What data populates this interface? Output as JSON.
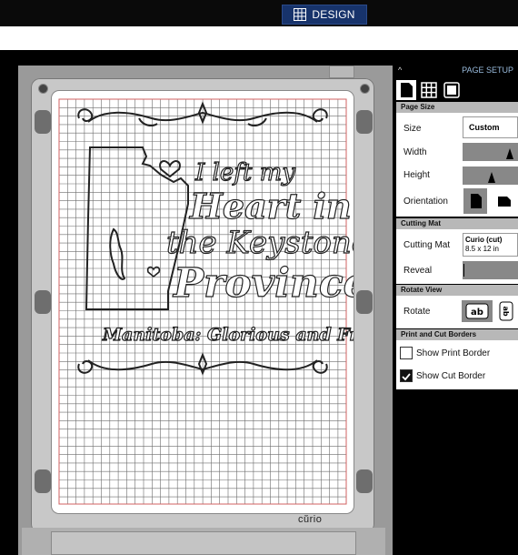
{
  "toolbar": {
    "design_tab_label": "DESIGN",
    "design_icon": "grid-icon"
  },
  "mat": {
    "brand_logo": "cŭrio",
    "design_text_lines": [
      "I left my",
      "Heart in",
      "the Keystone",
      "Province"
    ],
    "design_tagline": "Manitoba: Glorious and Free"
  },
  "panel": {
    "collapse_icon": "chevron-up-icon",
    "title": "PAGE SETUP",
    "view_icons": [
      "page-icon",
      "grid-icon",
      "mat-icon"
    ],
    "page_size": {
      "section": "Page Size",
      "size_label": "Size",
      "size_value": "Custom",
      "width_label": "Width",
      "height_label": "Height",
      "orientation_label": "Orientation",
      "orientation_icons": [
        "portrait-icon",
        "landscape-icon"
      ]
    },
    "cutting_mat": {
      "section": "Cutting Mat",
      "label": "Cutting Mat",
      "value_line1": "Curio (cut)",
      "value_line2": "8.5 x 12 in",
      "reveal_label": "Reveal"
    },
    "rotate_view": {
      "section": "Rotate View",
      "label": "Rotate",
      "rotate_icons": [
        "rotate-ab-icon",
        "rotate-ab-vertical-icon"
      ]
    },
    "borders": {
      "section": "Print and Cut Borders",
      "show_print_label": "Show Print Border",
      "show_print_checked": false,
      "show_cut_label": "Show Cut Border",
      "show_cut_checked": true
    }
  },
  "colors": {
    "design_tab_bg": "#17336b",
    "section_header": "#b8b8b8",
    "grid_line": "#6c6c6c",
    "border_line": "#d06060"
  }
}
